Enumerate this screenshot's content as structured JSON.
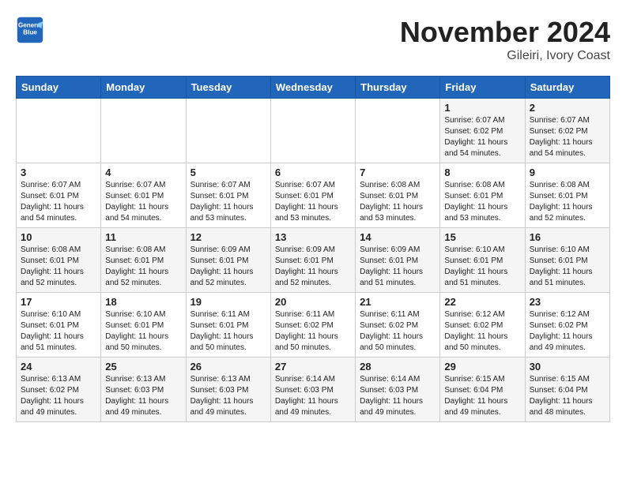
{
  "header": {
    "logo_line1": "General",
    "logo_line2": "Blue",
    "month": "November 2024",
    "location": "Gileiri, Ivory Coast"
  },
  "weekdays": [
    "Sunday",
    "Monday",
    "Tuesday",
    "Wednesday",
    "Thursday",
    "Friday",
    "Saturday"
  ],
  "weeks": [
    [
      {
        "day": "",
        "info": ""
      },
      {
        "day": "",
        "info": ""
      },
      {
        "day": "",
        "info": ""
      },
      {
        "day": "",
        "info": ""
      },
      {
        "day": "",
        "info": ""
      },
      {
        "day": "1",
        "info": "Sunrise: 6:07 AM\nSunset: 6:02 PM\nDaylight: 11 hours\nand 54 minutes."
      },
      {
        "day": "2",
        "info": "Sunrise: 6:07 AM\nSunset: 6:02 PM\nDaylight: 11 hours\nand 54 minutes."
      }
    ],
    [
      {
        "day": "3",
        "info": "Sunrise: 6:07 AM\nSunset: 6:01 PM\nDaylight: 11 hours\nand 54 minutes."
      },
      {
        "day": "4",
        "info": "Sunrise: 6:07 AM\nSunset: 6:01 PM\nDaylight: 11 hours\nand 54 minutes."
      },
      {
        "day": "5",
        "info": "Sunrise: 6:07 AM\nSunset: 6:01 PM\nDaylight: 11 hours\nand 53 minutes."
      },
      {
        "day": "6",
        "info": "Sunrise: 6:07 AM\nSunset: 6:01 PM\nDaylight: 11 hours\nand 53 minutes."
      },
      {
        "day": "7",
        "info": "Sunrise: 6:08 AM\nSunset: 6:01 PM\nDaylight: 11 hours\nand 53 minutes."
      },
      {
        "day": "8",
        "info": "Sunrise: 6:08 AM\nSunset: 6:01 PM\nDaylight: 11 hours\nand 53 minutes."
      },
      {
        "day": "9",
        "info": "Sunrise: 6:08 AM\nSunset: 6:01 PM\nDaylight: 11 hours\nand 52 minutes."
      }
    ],
    [
      {
        "day": "10",
        "info": "Sunrise: 6:08 AM\nSunset: 6:01 PM\nDaylight: 11 hours\nand 52 minutes."
      },
      {
        "day": "11",
        "info": "Sunrise: 6:08 AM\nSunset: 6:01 PM\nDaylight: 11 hours\nand 52 minutes."
      },
      {
        "day": "12",
        "info": "Sunrise: 6:09 AM\nSunset: 6:01 PM\nDaylight: 11 hours\nand 52 minutes."
      },
      {
        "day": "13",
        "info": "Sunrise: 6:09 AM\nSunset: 6:01 PM\nDaylight: 11 hours\nand 52 minutes."
      },
      {
        "day": "14",
        "info": "Sunrise: 6:09 AM\nSunset: 6:01 PM\nDaylight: 11 hours\nand 51 minutes."
      },
      {
        "day": "15",
        "info": "Sunrise: 6:10 AM\nSunset: 6:01 PM\nDaylight: 11 hours\nand 51 minutes."
      },
      {
        "day": "16",
        "info": "Sunrise: 6:10 AM\nSunset: 6:01 PM\nDaylight: 11 hours\nand 51 minutes."
      }
    ],
    [
      {
        "day": "17",
        "info": "Sunrise: 6:10 AM\nSunset: 6:01 PM\nDaylight: 11 hours\nand 51 minutes."
      },
      {
        "day": "18",
        "info": "Sunrise: 6:10 AM\nSunset: 6:01 PM\nDaylight: 11 hours\nand 50 minutes."
      },
      {
        "day": "19",
        "info": "Sunrise: 6:11 AM\nSunset: 6:01 PM\nDaylight: 11 hours\nand 50 minutes."
      },
      {
        "day": "20",
        "info": "Sunrise: 6:11 AM\nSunset: 6:02 PM\nDaylight: 11 hours\nand 50 minutes."
      },
      {
        "day": "21",
        "info": "Sunrise: 6:11 AM\nSunset: 6:02 PM\nDaylight: 11 hours\nand 50 minutes."
      },
      {
        "day": "22",
        "info": "Sunrise: 6:12 AM\nSunset: 6:02 PM\nDaylight: 11 hours\nand 50 minutes."
      },
      {
        "day": "23",
        "info": "Sunrise: 6:12 AM\nSunset: 6:02 PM\nDaylight: 11 hours\nand 49 minutes."
      }
    ],
    [
      {
        "day": "24",
        "info": "Sunrise: 6:13 AM\nSunset: 6:02 PM\nDaylight: 11 hours\nand 49 minutes."
      },
      {
        "day": "25",
        "info": "Sunrise: 6:13 AM\nSunset: 6:03 PM\nDaylight: 11 hours\nand 49 minutes."
      },
      {
        "day": "26",
        "info": "Sunrise: 6:13 AM\nSunset: 6:03 PM\nDaylight: 11 hours\nand 49 minutes."
      },
      {
        "day": "27",
        "info": "Sunrise: 6:14 AM\nSunset: 6:03 PM\nDaylight: 11 hours\nand 49 minutes."
      },
      {
        "day": "28",
        "info": "Sunrise: 6:14 AM\nSunset: 6:03 PM\nDaylight: 11 hours\nand 49 minutes."
      },
      {
        "day": "29",
        "info": "Sunrise: 6:15 AM\nSunset: 6:04 PM\nDaylight: 11 hours\nand 49 minutes."
      },
      {
        "day": "30",
        "info": "Sunrise: 6:15 AM\nSunset: 6:04 PM\nDaylight: 11 hours\nand 48 minutes."
      }
    ]
  ]
}
